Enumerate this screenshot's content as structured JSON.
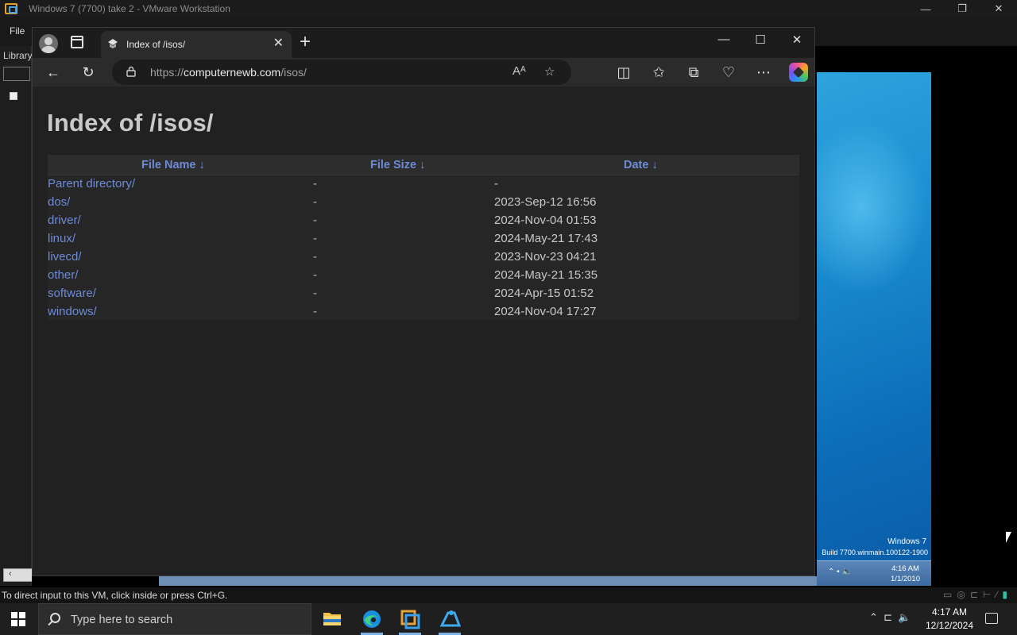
{
  "vmware": {
    "title": "Windows 7 (7700) take 2 - VMware Workstation",
    "menu_file": "File",
    "library_label": "Library",
    "status_text": "To direct input to this VM, click inside or press Ctrl+G.",
    "guest": {
      "brand": "Windows 7",
      "build": "Build 7700.winmain.100122-1900",
      "clock_time": "4:16 AM",
      "clock_date": "1/1/2010"
    }
  },
  "browser": {
    "tab_title": "Index of /isos/",
    "url_scheme": "https://",
    "url_domain": "computernewb.com",
    "url_path": "/isos/"
  },
  "page": {
    "heading": "Index of /isos/",
    "columns": [
      "File Name  ↓",
      "File Size  ↓",
      "Date  ↓"
    ],
    "rows": [
      {
        "name": "Parent directory/",
        "size": "-",
        "date": "-"
      },
      {
        "name": "dos/",
        "size": "-",
        "date": "2023-Sep-12 16:56"
      },
      {
        "name": "driver/",
        "size": "-",
        "date": "2024-Nov-04 01:53"
      },
      {
        "name": "linux/",
        "size": "-",
        "date": "2024-May-21 17:43"
      },
      {
        "name": "livecd/",
        "size": "-",
        "date": "2023-Nov-23 04:21"
      },
      {
        "name": "other/",
        "size": "-",
        "date": "2024-May-21 15:35"
      },
      {
        "name": "software/",
        "size": "-",
        "date": "2024-Apr-15 01:52"
      },
      {
        "name": "windows/",
        "size": "-",
        "date": "2024-Nov-04 17:27"
      }
    ]
  },
  "taskbar": {
    "search_placeholder": "Type here to search",
    "clock_time": "4:17 AM",
    "clock_date": "12/12/2024",
    "apps": [
      "file-explorer",
      "edge",
      "vmware-workstation",
      "other-app"
    ]
  },
  "colors": {
    "link": "#6e8bd8",
    "heading": "#c9c9c9",
    "page_bg": "#212121"
  }
}
